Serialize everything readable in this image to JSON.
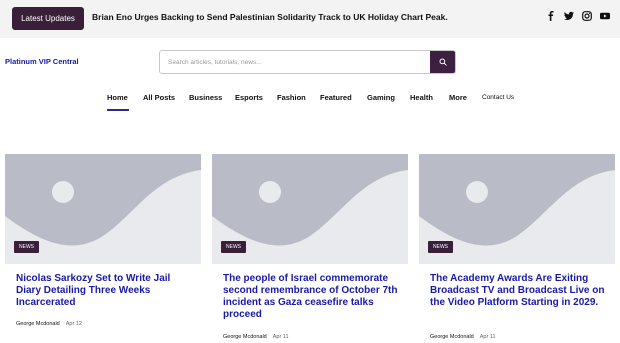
{
  "topbar": {
    "latest_label": "Latest Updates",
    "ticker_text": "Brian Eno Urges Backing to Send Palestinian Solidarity Track to UK Holiday Chart Peak.",
    "social_icons": [
      "facebook-icon",
      "twitter-icon",
      "instagram-icon",
      "youtube-icon"
    ]
  },
  "header": {
    "site_title": "Platinum VIP Central",
    "search_placeholder": "Search articles, tutorials, news..."
  },
  "nav": {
    "items": [
      "Home",
      "All Posts",
      "Business",
      "Esports",
      "Fashion",
      "Featured",
      "Gaming",
      "Health",
      "More",
      "Contact Us"
    ],
    "active": "Home"
  },
  "cards": [
    {
      "tag": "NEWS",
      "title": "Nicolas Sarkozy Set to Write Jail Diary Detailing Three Weeks Incarcerated",
      "author": "George Mcdonald",
      "date": "Apr 12"
    },
    {
      "tag": "NEWS",
      "title": "The people of Israel commemorate second remembrance of October 7th incident as Gaza ceasefire talks proceed",
      "author": "George Mcdonald",
      "date": "Apr 11"
    },
    {
      "tag": "NEWS",
      "title": "The Academy Awards Are Exiting Broadcast TV and Broadcast Live on the Video Platform Starting in 2029.",
      "author": "George Mcdonald",
      "date": "Apr 11"
    }
  ],
  "colors": {
    "accent_dark": "#3a1f3b",
    "link_blue": "#1a1aa8",
    "nav_underline": "#2d2b8f"
  }
}
